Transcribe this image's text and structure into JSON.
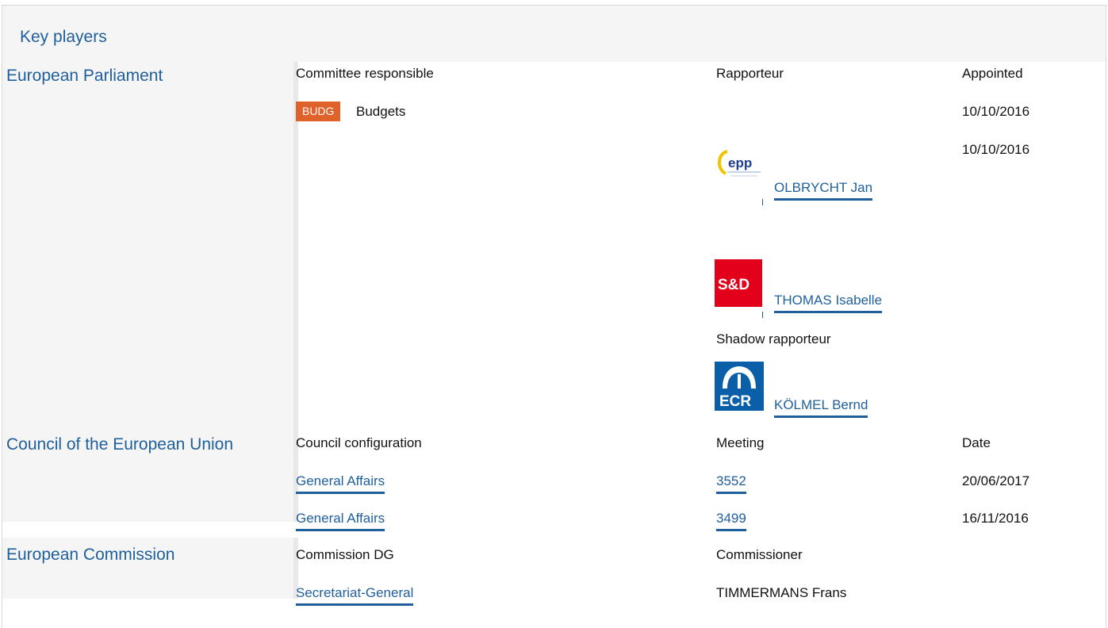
{
  "panel": {
    "title": "Key players"
  },
  "parliament": {
    "title": "European Parliament",
    "col_committee": "Committee responsible",
    "col_rapporteur": "Rapporteur",
    "col_appointed": "Appointed",
    "committee": {
      "badge": "BUDG",
      "badge_color": "#e0622b",
      "name": "Budgets"
    },
    "appointed_dates": [
      "10/10/2016",
      "10/10/2016"
    ],
    "rapporteurs": [
      {
        "group": "epp",
        "group_logo_text": "epp",
        "name": "OLBRYCHT Jan"
      },
      {
        "group": "S&D",
        "group_logo_text": "S&D",
        "name": "THOMAS Isabelle"
      }
    ],
    "shadow_label": "Shadow rapporteur",
    "shadow": {
      "group": "ECR",
      "group_logo_text": "ECR",
      "name": "KÖLMEL Bernd"
    }
  },
  "council": {
    "title": "Council of the European Union",
    "col_config": "Council configuration",
    "col_meeting": "Meeting",
    "col_date": "Date",
    "rows": [
      {
        "config": "General Affairs",
        "meeting": "3552",
        "date": "20/06/2017"
      },
      {
        "config": "General Affairs",
        "meeting": "3499",
        "date": "16/11/2016"
      }
    ]
  },
  "commission": {
    "title": "European Commission",
    "col_dg": "Commission DG",
    "col_commissioner": "Commissioner",
    "dg": "Secretariat-General",
    "commissioner": "TIMMERMANS Frans"
  },
  "colors": {
    "link": "#1f5f9c",
    "sd_red": "#e2001a",
    "ecr_blue": "#0a5fa8",
    "epp_blue": "#1e3f8f"
  }
}
